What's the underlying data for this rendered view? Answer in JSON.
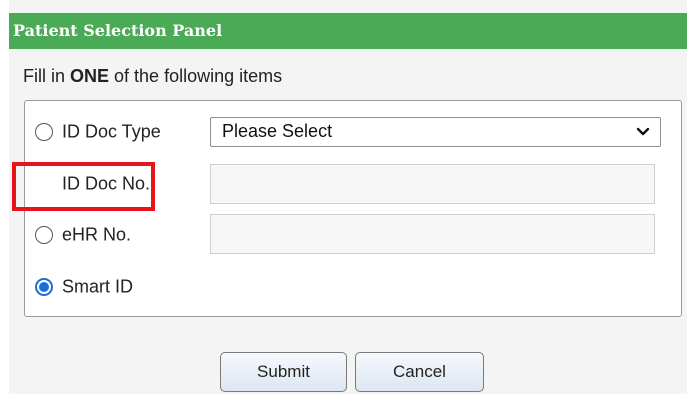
{
  "panel": {
    "title": "Patient Selection Panel"
  },
  "instruction": {
    "prefix": "Fill in ",
    "emphasis": "ONE",
    "suffix": " of the following items"
  },
  "options": {
    "id_doc_type": {
      "label": "ID Doc Type",
      "selected": false,
      "select_value": "Please Select"
    },
    "id_doc_no": {
      "label": "ID Doc No.",
      "value": ""
    },
    "ehr_no": {
      "label": "eHR No.",
      "selected": false,
      "value": ""
    },
    "smart_id": {
      "label": "Smart ID",
      "selected": true
    }
  },
  "actions": {
    "submit_label": "Submit",
    "cancel_label": "Cancel"
  },
  "colors": {
    "header_green": "#4aaa55",
    "radio_selected": "#1a6ed8",
    "highlight_red": "#e8141a"
  }
}
